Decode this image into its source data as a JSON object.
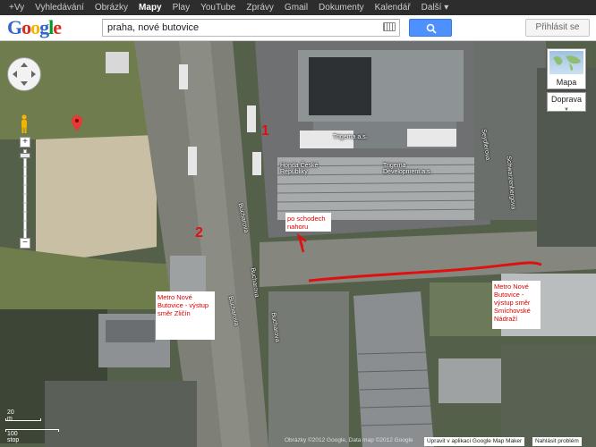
{
  "gbar": {
    "items": [
      "+Vy",
      "Vyhledávání",
      "Obrázky",
      "Mapy",
      "Play",
      "YouTube",
      "Zprávy",
      "Gmail",
      "Dokumenty",
      "Kalendář",
      "Další ▾"
    ],
    "active_index": 3
  },
  "header": {
    "logo": [
      "G",
      "o",
      "o",
      "g",
      "l",
      "e"
    ],
    "search_value": "praha, nové butovice",
    "signin_label": "Přihlásit se"
  },
  "controls": {
    "zoom_in": "+",
    "zoom_out": "−",
    "map_type_label": "Mapa",
    "traffic_label": "Doprava"
  },
  "map_labels": {
    "building1": "Trigema a.s.",
    "building2": "Honda České Republiky",
    "building3": "Trigema Development a.s.",
    "street1": "Bucharova",
    "street2": "Bucharova",
    "street3": "Bucharova",
    "street4": "Bucharova",
    "street5": "Seydlerova",
    "street6": "Schwarzenbergova"
  },
  "annotations": {
    "num1": "1",
    "num2": "2",
    "note1": "po schodech nahoru",
    "note2": "Metro Nové Butovice - výstup směr Zličín",
    "note3": "Metro Nové Butovice - výstup směr Smíchovské Nádraží"
  },
  "scale": {
    "top": "20 m",
    "bottom": "100 stop"
  },
  "footer": {
    "copyright": "Obrázky ©2012 Google, Data map ©2012 Google",
    "open_in_map_maker": "Upravit v aplikaci Google Map Maker",
    "report_problem": "Nahlásit problém"
  },
  "colors": {
    "accent_blue": "#4d90fe",
    "annotation_red": "#e01010"
  }
}
